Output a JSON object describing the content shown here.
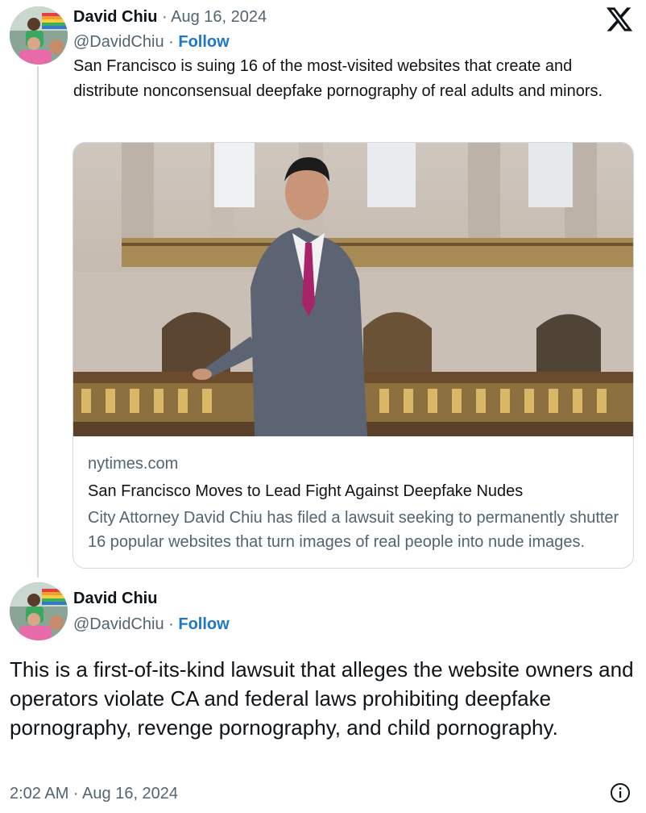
{
  "thread": {
    "original_tweet": {
      "author_name": "David Chiu",
      "separator": "·",
      "date": "Aug 16, 2024",
      "handle": "@DavidChiu",
      "follow_label": "Follow",
      "text": "San Francisco is suing 16 of the most-visited websites that create and distribute nonconsensual deepfake pornography of real adults and minors.",
      "platform_icon": "x-logo-icon"
    },
    "link_card": {
      "domain": "nytimes.com",
      "title": "San Francisco Moves to Lead Fight Against Deepfake Nudes",
      "description": "City Attorney David Chiu has filed a lawsuit seeking to permanently shutter 16 popular websites that turn images of real people into nude images."
    },
    "reply_tweet": {
      "author_name": "David Chiu",
      "handle": "@DavidChiu",
      "separator": "·",
      "follow_label": "Follow",
      "text": "This is a first-of-its-kind lawsuit that alleges the website owners and operators violate CA and federal laws prohibiting deepfake pornography, revenge pornography, and child pornography.",
      "timestamp": "2:02 AM · Aug 16, 2024",
      "info_icon": "info-icon"
    }
  },
  "colors": {
    "text_primary": "#0f1419",
    "text_secondary": "#536471",
    "follow_blue": "#1d77c8",
    "border": "#cfd9de"
  }
}
